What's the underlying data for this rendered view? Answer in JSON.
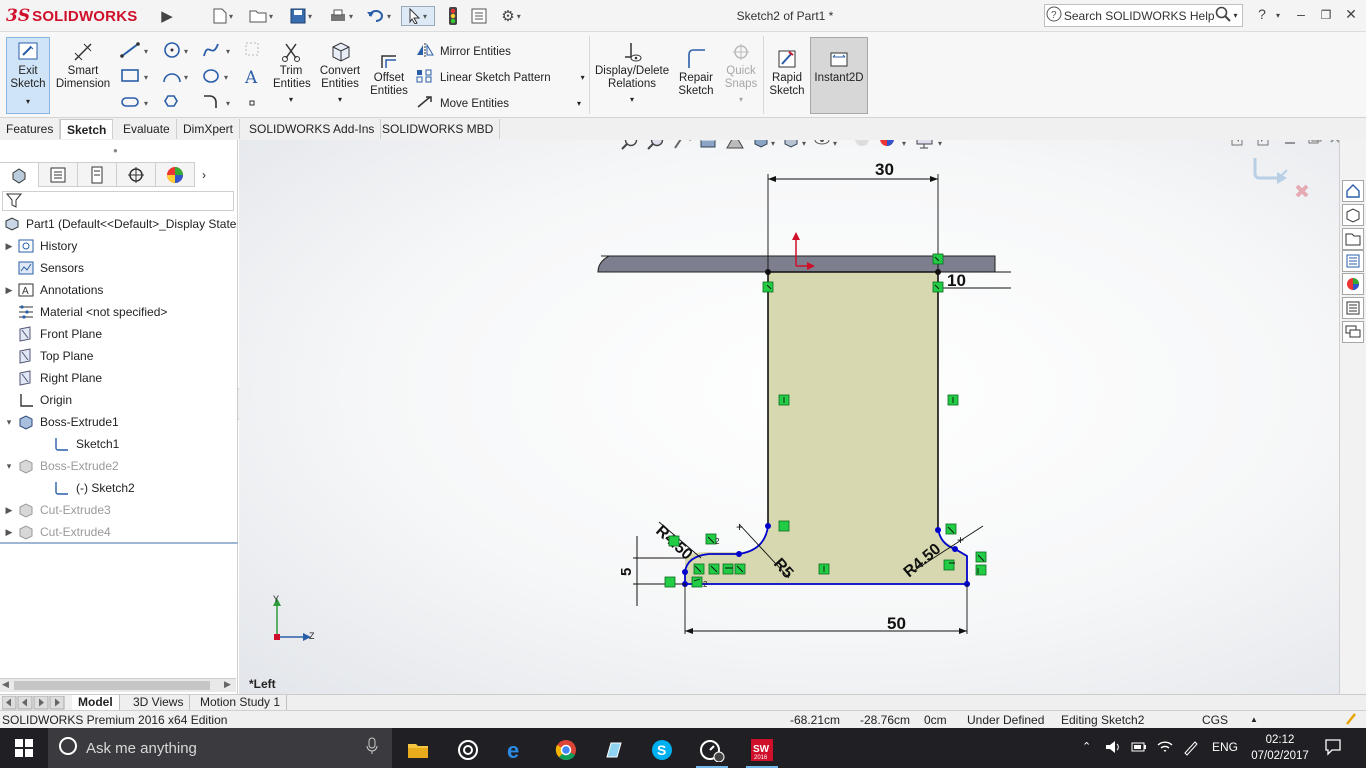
{
  "app": {
    "brand_ds": "3S",
    "brand_name": "SOLIDWORKS",
    "document_title": "Sketch2 of Part1 *"
  },
  "search": {
    "placeholder": "Search SOLIDWORKS Help"
  },
  "ribbon": {
    "exit_sketch": "Exit Sketch",
    "smart_dimension": "Smart Dimension",
    "trim_entities": "Trim Entities",
    "convert_entities": "Convert Entities",
    "offset_entities": "Offset Entities",
    "mirror_entities": "Mirror Entities",
    "linear_sketch_pattern": "Linear Sketch Pattern",
    "move_entities": "Move Entities",
    "display_delete_relations": "Display/Delete Relations",
    "repair_sketch": "Repair Sketch",
    "quick_snaps": "Quick Snaps",
    "rapid_sketch": "Rapid Sketch",
    "instant2d": "Instant2D"
  },
  "tabs": [
    "Features",
    "Sketch",
    "Evaluate",
    "DimXpert",
    "SOLIDWORKS Add-Ins",
    "SOLIDWORKS MBD"
  ],
  "tree": {
    "root": "Part1  (Default<<Default>_Display State",
    "items": [
      {
        "label": "History",
        "expandable": true,
        "grey": false
      },
      {
        "label": "Sensors",
        "expandable": false,
        "grey": false
      },
      {
        "label": "Annotations",
        "expandable": true,
        "grey": false
      },
      {
        "label": "Material <not specified>",
        "expandable": false,
        "grey": false
      },
      {
        "label": "Front Plane",
        "expandable": false,
        "grey": false
      },
      {
        "label": "Top Plane",
        "expandable": false,
        "grey": false
      },
      {
        "label": "Right Plane",
        "expandable": false,
        "grey": false
      },
      {
        "label": "Origin",
        "expandable": false,
        "grey": false
      },
      {
        "label": "Boss-Extrude1",
        "expandable": true,
        "grey": false
      },
      {
        "label": "Sketch1",
        "expandable": false,
        "grey": false
      },
      {
        "label": "Boss-Extrude2",
        "expandable": true,
        "grey": true
      },
      {
        "label": "(-) Sketch2",
        "expandable": false,
        "grey": false
      },
      {
        "label": "Cut-Extrude3",
        "expandable": true,
        "grey": true
      },
      {
        "label": "Cut-Extrude4",
        "expandable": true,
        "grey": true
      }
    ]
  },
  "viewport": {
    "view_name": "*Left",
    "dimensions": {
      "top_width": "30",
      "step": "10",
      "bottom_width": "50",
      "left_height": "5",
      "radius_small": "R5",
      "radius_left": "R4.50",
      "radius_right": "R4.50",
      "triad_y": "Y",
      "triad_z": "Z"
    }
  },
  "bottom_tabs": [
    "Model",
    "3D Views",
    "Motion Study 1"
  ],
  "status": {
    "edition": "SOLIDWORKS Premium 2016 x64 Edition",
    "x": "-68.21cm",
    "y": "-28.76cm",
    "z": "0cm",
    "state": "Under Defined",
    "editing": "Editing Sketch2",
    "units": "CGS"
  },
  "taskbar": {
    "search_placeholder": "Ask me anything",
    "language": "ENG",
    "time": "02:12",
    "date": "07/02/2017"
  },
  "colors": {
    "accent_red": "#d0102b",
    "sketch_fill": "#d8d8b0",
    "relation_green": "#22cc44",
    "sketch_blue": "#0000cc",
    "taskbar": "#1f1f24"
  }
}
